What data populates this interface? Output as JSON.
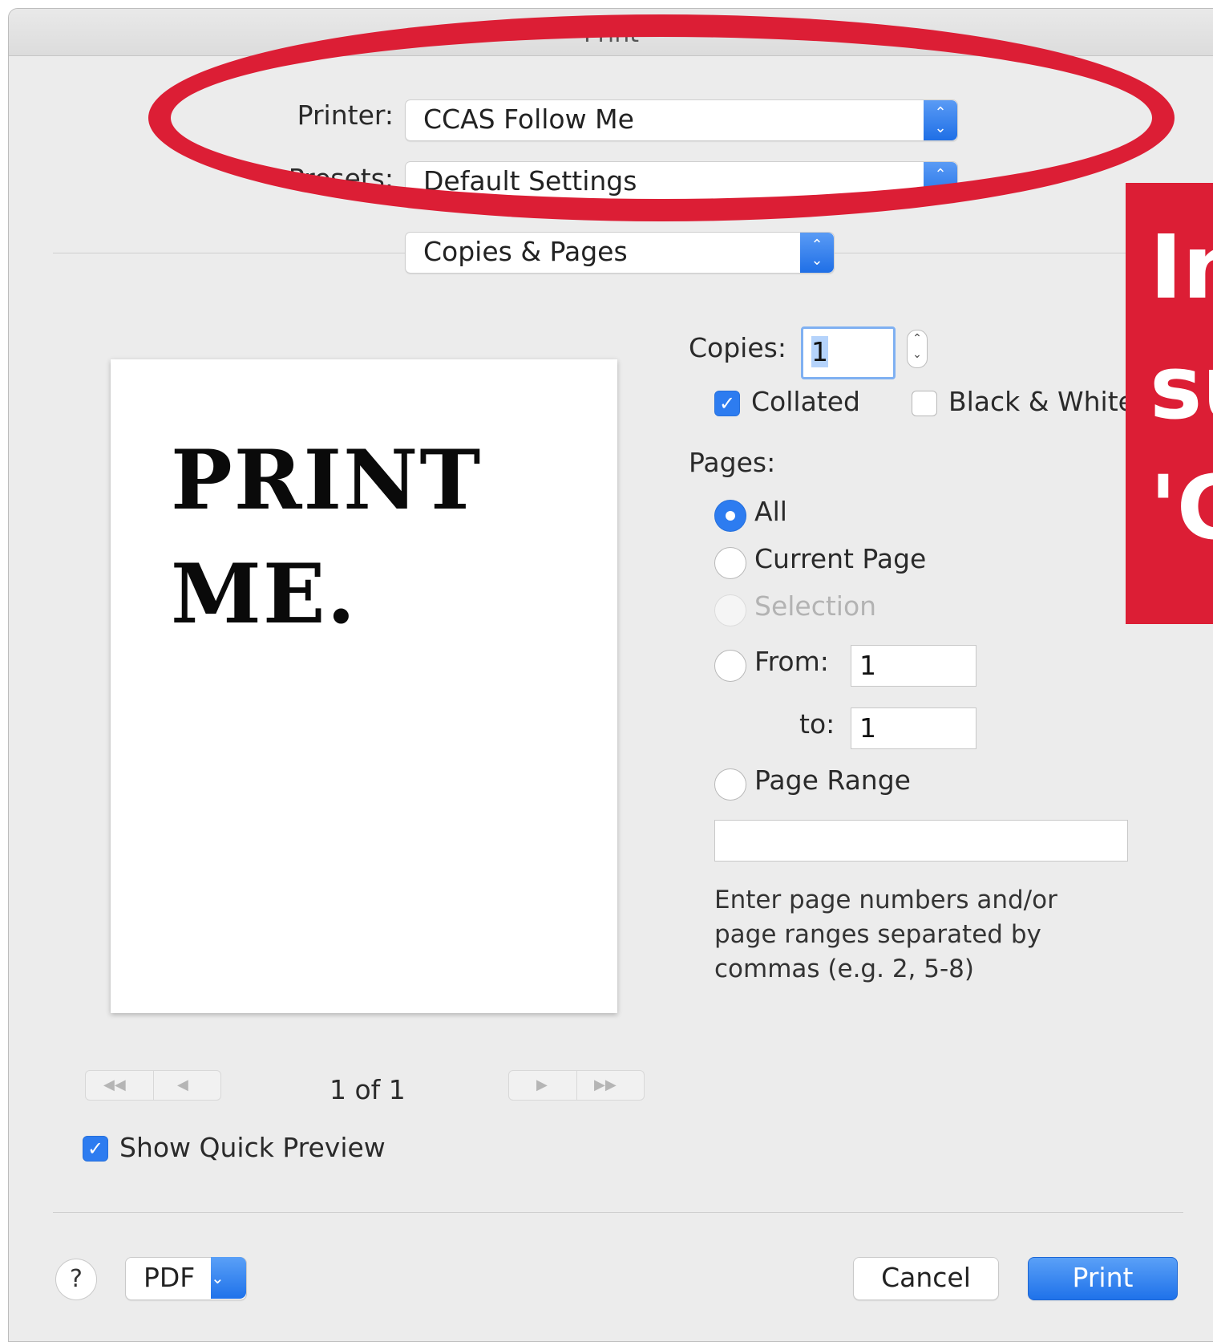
{
  "window": {
    "title": "Print"
  },
  "printer": {
    "label": "Printer:",
    "value": "CCAS Follow Me"
  },
  "presets": {
    "label": "Presets:",
    "value": "Default Settings"
  },
  "section": {
    "value": "Copies & Pages"
  },
  "copies": {
    "label": "Copies:",
    "value": "1"
  },
  "collated": {
    "label": "Collated",
    "checked": true
  },
  "black_white": {
    "label": "Black & White",
    "checked": false
  },
  "pages": {
    "label": "Pages:",
    "options": [
      {
        "label": "All",
        "selected": true,
        "enabled": true
      },
      {
        "label": "Current Page",
        "selected": false,
        "enabled": true
      },
      {
        "label": "Selection",
        "selected": false,
        "enabled": false
      },
      {
        "label": "From:",
        "selected": false,
        "enabled": true
      },
      {
        "label": "Page Range",
        "selected": false,
        "enabled": true
      }
    ],
    "from_value": "1",
    "to_label": "to:",
    "to_value": "1",
    "range_value": "",
    "hint": "Enter page numbers and/or page ranges separated by commas (e.g. 2, 5-8)"
  },
  "preview": {
    "page_text_line1": "PRINT",
    "page_text_line2": "ME.",
    "page_indicator": "1 of 1",
    "first_icon": "◀◀",
    "prev_icon": "◀",
    "next_icon": "▶",
    "last_icon": "▶▶"
  },
  "quick_preview": {
    "label": "Show Quick Preview",
    "checked": true
  },
  "footer": {
    "help_label": "?",
    "pdf_label": "PDF",
    "cancel_label": "Cancel",
    "print_label": "Print"
  },
  "overlay": {
    "lines": [
      "In",
      "su",
      "'C"
    ],
    "color": "#dc1e35"
  },
  "colors": {
    "accent": "#2d7cf0",
    "annotation": "#dc1e35"
  }
}
